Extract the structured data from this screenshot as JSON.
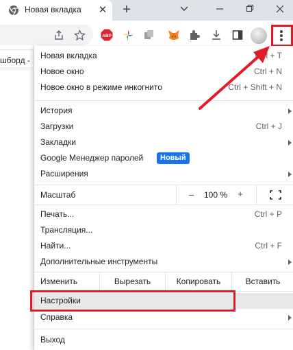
{
  "tab": {
    "title": "Новая вкладка",
    "close": "✕"
  },
  "window_controls": {
    "new_tab": "+"
  },
  "bookmarks_bar": {
    "partial_label": "шборд -"
  },
  "extensions": {
    "abp": "ABP"
  },
  "menu": {
    "group1": [
      {
        "label": "Новая вкладка",
        "shortcut": "Ctrl + T"
      },
      {
        "label": "Новое окно",
        "shortcut": "Ctrl + N"
      },
      {
        "label": "Новое окно в режиме инкогнито",
        "shortcut": "Ctrl + Shift + N"
      }
    ],
    "group2": [
      {
        "label": "История",
        "shortcut": ""
      },
      {
        "label": "Загрузки",
        "shortcut": "Ctrl + J"
      },
      {
        "label": "Закладки",
        "shortcut": ""
      },
      {
        "label": "Google Менеджер паролей",
        "shortcut": ""
      },
      {
        "label": "Расширения",
        "shortcut": ""
      }
    ],
    "password_badge": "Новый",
    "zoom": {
      "label": "Масштаб",
      "minus": "–",
      "value": "100 %",
      "plus": "+"
    },
    "group3": [
      {
        "label": "Печать...",
        "shortcut": "Ctrl + P"
      },
      {
        "label": "Трансляция...",
        "shortcut": ""
      },
      {
        "label": "Найти...",
        "shortcut": "Ctrl + F"
      },
      {
        "label": "Дополнительные инструменты",
        "shortcut": ""
      }
    ],
    "edit": {
      "label": "Изменить",
      "cut": "Вырезать",
      "copy": "Копировать",
      "paste": "Вставить"
    },
    "group4": [
      {
        "label": "Настройки",
        "shortcut": ""
      },
      {
        "label": "Справка",
        "shortcut": ""
      }
    ],
    "exit": "Выход"
  },
  "colors": {
    "annotation": "#e21b27",
    "badge": "#1a73e8",
    "titlebar": "#dee1e6"
  }
}
